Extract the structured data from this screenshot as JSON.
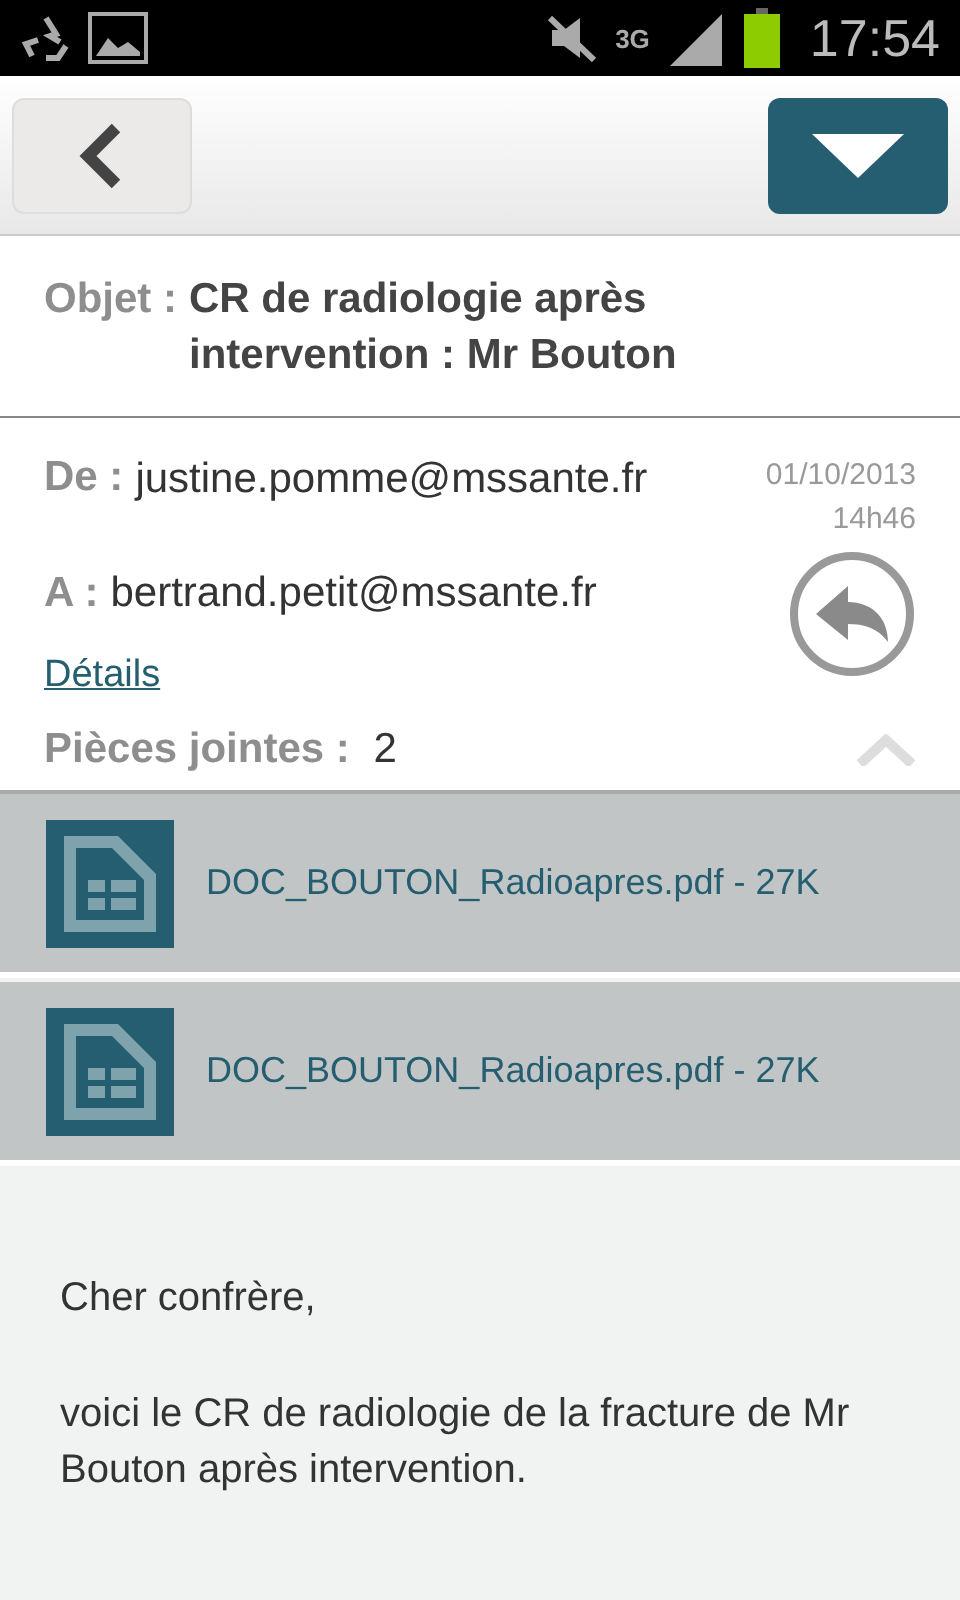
{
  "status_bar": {
    "network": "3G",
    "time": "17:54"
  },
  "subject": {
    "label": "Objet :",
    "value": "CR de radiologie après intervention : Mr Bouton"
  },
  "header": {
    "from_label": "De :",
    "from": "justine.pomme@mssante.fr",
    "date": "01/10/2013",
    "time": "14h46",
    "to_label": "A :",
    "to": "bertrand.petit@mssante.fr",
    "details_link": "Détails",
    "attachments_label": "Pièces jointes :",
    "attachments_count": "2",
    "expanded": true
  },
  "attachments": [
    {
      "name": "DOC_BOUTON_Radioapres.pdf - 27K"
    },
    {
      "name": "DOC_BOUTON_Radioapres.pdf - 27K"
    }
  ],
  "body": [
    "Cher confrère,",
    "voici le CR de radiologie de la fracture de Mr Bouton après intervention."
  ]
}
